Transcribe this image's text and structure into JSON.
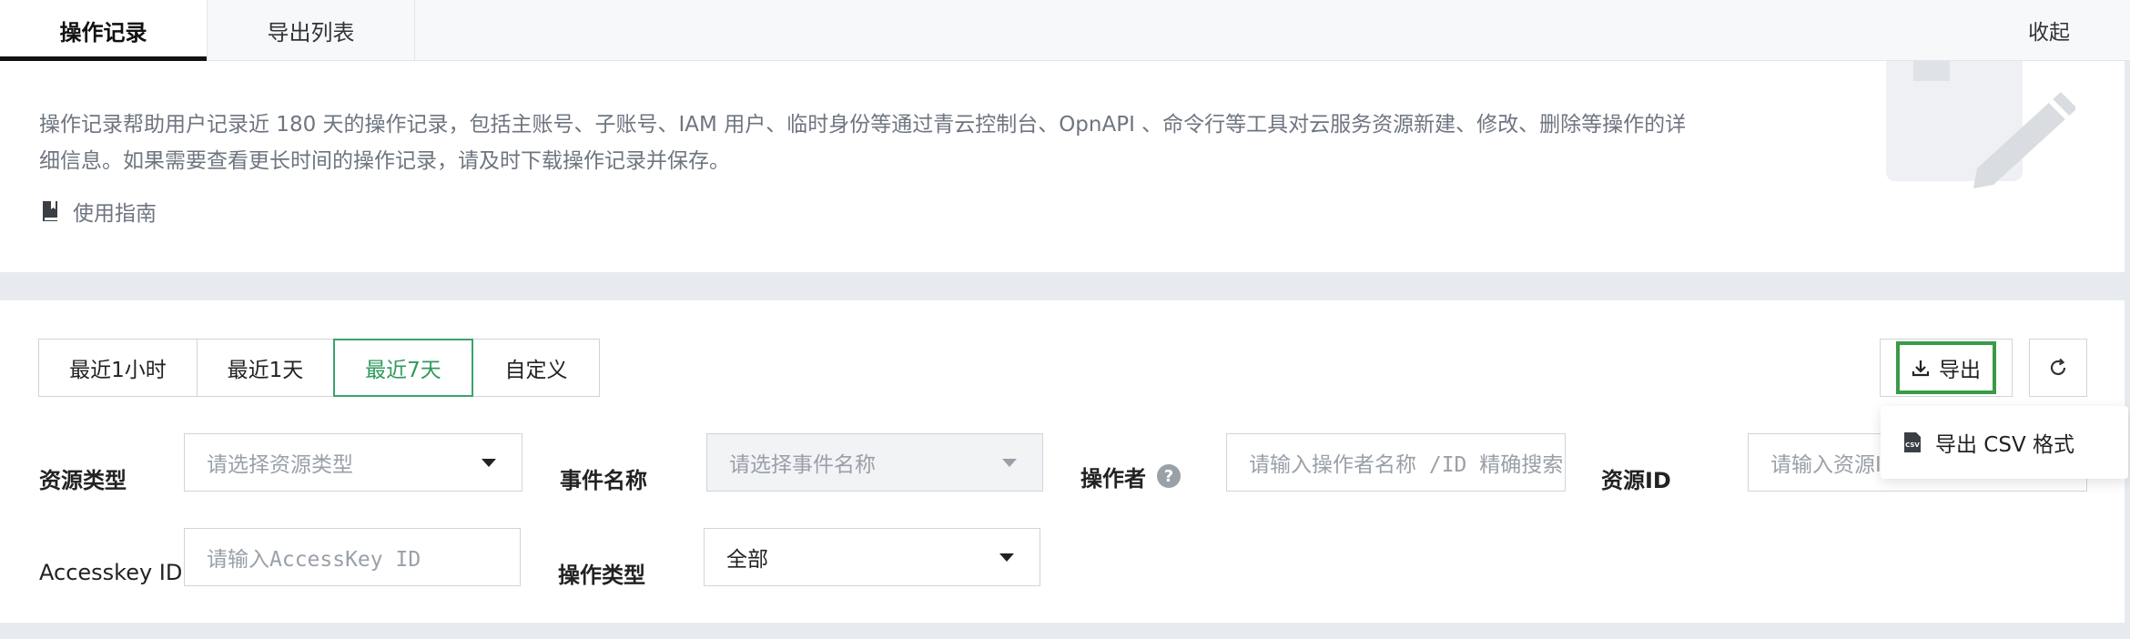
{
  "tabs": [
    {
      "label": "操作记录",
      "active": true
    },
    {
      "label": "导出列表",
      "active": false
    }
  ],
  "collapse_label": "收起",
  "intro": {
    "line1": "操作记录帮助用户记录近 180 天的操作记录，包括主账号、子账号、IAM 用户、临时身份等通过青云控制台、OpnAPI 、命令行等工具对云服务资源新建、修改、删除等操作的详",
    "line2": "细信息。如果需要查看更长时间的操作记录，请及时下载操作记录并保存。",
    "guide_label": "使用指南",
    "guide_icon": "book-icon"
  },
  "time_range": {
    "options": [
      "最近1小时",
      "最近1天",
      "最近7天",
      "自定义"
    ],
    "selected": "最近7天"
  },
  "toolbar": {
    "export_label": "导出",
    "export_icon": "download-icon",
    "refresh_icon": "refresh-icon",
    "export_menu": [
      {
        "label": "导出 CSV 格式",
        "icon": "csv-file-icon"
      }
    ]
  },
  "filters": {
    "resource_type": {
      "label": "资源类型",
      "placeholder": "请选择资源类型"
    },
    "event_name": {
      "label": "事件名称",
      "placeholder": "请选择事件名称",
      "disabled": true
    },
    "operator": {
      "label": "操作者",
      "placeholder": "请输入操作者名称 /ID 精确搜索",
      "help_icon": "question-icon"
    },
    "resource_id": {
      "label": "资源ID",
      "placeholder": "请输入资源ID"
    },
    "access_key": {
      "label": "Accesskey ID",
      "placeholder": "请输入AccessKey ID"
    },
    "operation_type": {
      "label": "操作类型",
      "value": "全部"
    }
  },
  "colors": {
    "accent_green": "#2f9a5e",
    "highlight_green": "#3a9a47",
    "page_bg": "#e7ebf0",
    "muted_text": "#6e7580"
  }
}
